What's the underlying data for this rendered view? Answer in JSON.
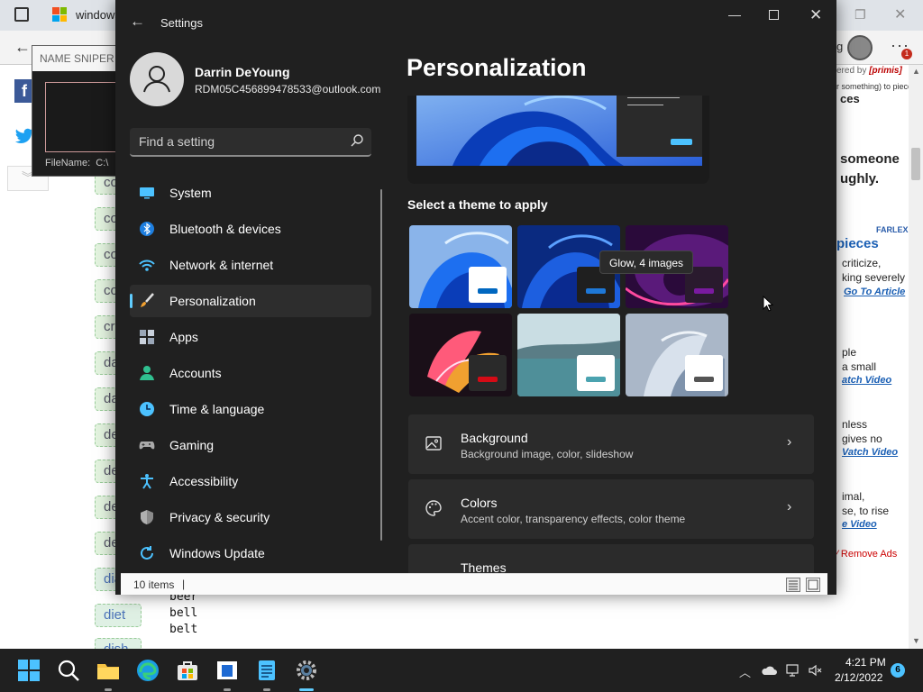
{
  "browser": {
    "tab_title": "windows",
    "profile_text": "g",
    "notification_count": "1"
  },
  "sniper": {
    "title": "NAME SNIPER",
    "filename_label": "FileName:",
    "filename_value": "C:\\"
  },
  "background_page": {
    "left_words": [
      "co",
      "co",
      "co",
      "co",
      "cr",
      "da",
      "da",
      "de",
      "de",
      "de",
      "de",
      "dia",
      "diet",
      "dish"
    ],
    "word_list": [
      "beer",
      "bell",
      "belt"
    ],
    "right_ad": {
      "powered_by": "ered by",
      "brand": "[primis]",
      "subtitle": "r something) to pieces",
      "heading": "ces",
      "line1": "someone",
      "line2": "ughly.",
      "farlex": "FARLEX",
      "pieces": "pieces",
      "def1": "criticize,",
      "def2": "king severely",
      "go_article": "Go To Article",
      "ex1": "ple",
      "ex2": "a small",
      "watch_video_1": "atch Video",
      "ex3": "nless",
      "ex4": "gives no",
      "watch_video_2": "Vatch Video",
      "ex5": "imal,",
      "ex6": "se, to rise",
      "watch_video_3": "e Video",
      "remove_ads": "Remove Ads"
    }
  },
  "settings": {
    "window_title": "Settings",
    "profile": {
      "name": "Darrin DeYoung",
      "email": "RDM05C456899478533@outlook.com"
    },
    "search_placeholder": "Find a setting",
    "nav": [
      {
        "label": "System",
        "icon": "monitor-icon",
        "color": "#4cc2ff"
      },
      {
        "label": "Bluetooth & devices",
        "icon": "bluetooth-icon",
        "color": "#1e90ff"
      },
      {
        "label": "Network & internet",
        "icon": "wifi-icon",
        "color": "#4cc2ff"
      },
      {
        "label": "Personalization",
        "icon": "brush-icon",
        "color": "#f0a030",
        "active": true
      },
      {
        "label": "Apps",
        "icon": "apps-icon",
        "color": "#9aa7b8"
      },
      {
        "label": "Accounts",
        "icon": "person-icon",
        "color": "#30c090"
      },
      {
        "label": "Time & language",
        "icon": "clock-globe-icon",
        "color": "#4cc2ff"
      },
      {
        "label": "Gaming",
        "icon": "controller-icon",
        "color": "#aaaaaa"
      },
      {
        "label": "Accessibility",
        "icon": "accessibility-icon",
        "color": "#4cc2ff"
      },
      {
        "label": "Privacy & security",
        "icon": "shield-icon",
        "color": "#9a9a9a"
      },
      {
        "label": "Windows Update",
        "icon": "update-icon",
        "color": "#4cc2ff"
      }
    ],
    "page_title": "Personalization",
    "themes_heading": "Select a theme to apply",
    "tooltip": "Glow, 4 images",
    "themes": [
      {
        "name": "windows-light",
        "bg": "#8ab4ea",
        "swatch": "#ffffff",
        "accent": "#0067c0"
      },
      {
        "name": "windows-dark",
        "bg": "#0a2a80",
        "swatch": "#1f1f1f",
        "accent": "#1e78d7"
      },
      {
        "name": "glow",
        "bg": "#2a0a3a",
        "swatch": "#2a1a2e",
        "accent": "#7a1aa0"
      },
      {
        "name": "captured-motion",
        "bg": "#1a0f18",
        "swatch": "#2a2a2a",
        "accent": "#d40b16"
      },
      {
        "name": "sunrise",
        "bg": "#6fa2ad",
        "swatch": "#ffffff",
        "accent": "#4ba3b0"
      },
      {
        "name": "flow",
        "bg": "#aab7c8",
        "swatch": "#ffffff",
        "accent": "#555555"
      }
    ],
    "cards": [
      {
        "title": "Background",
        "subtitle": "Background image, color, slideshow",
        "icon": "image-icon"
      },
      {
        "title": "Colors",
        "subtitle": "Accent color, transparency effects, color theme",
        "icon": "palette-icon"
      },
      {
        "title": "Themes",
        "subtitle": "",
        "icon": "brush-icon"
      }
    ]
  },
  "statusbar": {
    "items_text": "10 items",
    "separator": "|"
  },
  "taskbar": {
    "time": "4:21 PM",
    "date": "2/12/2022",
    "notification_count": "6",
    "apps": [
      "start",
      "search",
      "file-explorer",
      "edge",
      "store",
      "sniper-app",
      "notepad",
      "settings"
    ]
  },
  "colors": {
    "accent": "#60cdff",
    "window_bg": "#202020",
    "card_bg": "#2b2b2b"
  }
}
